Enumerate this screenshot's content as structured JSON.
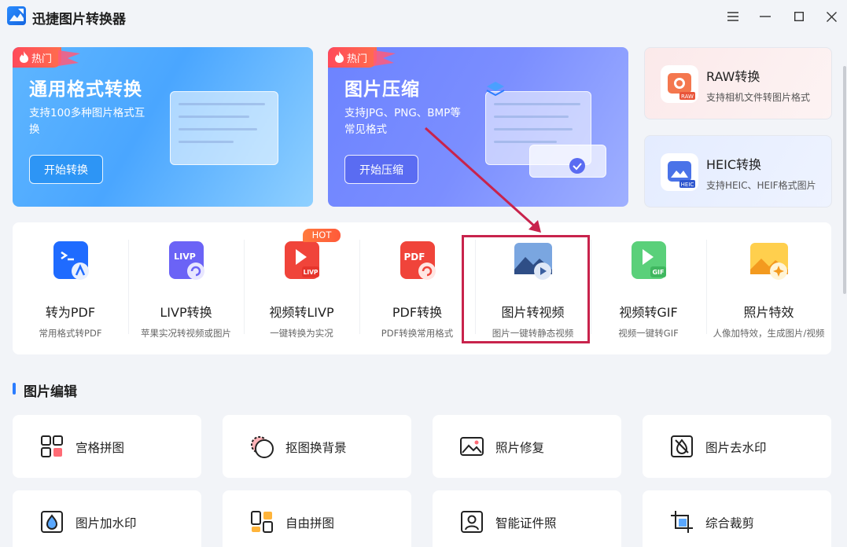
{
  "app": {
    "title": "迅捷图片转换器",
    "window_controls": [
      "menu-icon",
      "minimize-icon",
      "maximize-icon",
      "close-icon"
    ]
  },
  "banners": [
    {
      "tag": "热门",
      "title": "通用格式转换",
      "desc": "支持100多种图片格式互换",
      "button": "开始转换"
    },
    {
      "tag": "热门",
      "title": "图片压缩",
      "desc": "支持JPG、PNG、BMP等常见格式",
      "button": "开始压缩"
    }
  ],
  "side_cards": [
    {
      "title": "RAW转换",
      "sub": "支持相机文件转图片格式",
      "icon": "raw-icon",
      "icon_badge": "RAW"
    },
    {
      "title": "HEIC转换",
      "sub": "支持HEIC、HEIF格式图片",
      "icon": "heic-icon",
      "icon_badge": "HEIC"
    }
  ],
  "tools": [
    {
      "name": "转为PDF",
      "sub": "常用格式转PDF",
      "icon": "to-pdf-icon",
      "color": "#1f6bff"
    },
    {
      "name": "LIVP转换",
      "sub": "苹果实况转视频或图片",
      "icon": "livp-icon",
      "color": "#6b63f6",
      "icon_text": "LIVP"
    },
    {
      "name": "视频转LIVP",
      "sub": "一键转换为实况",
      "icon": "video-to-livp-icon",
      "color": "#f0443a",
      "badge": "HOT",
      "icon_text": "LIVP"
    },
    {
      "name": "PDF转换",
      "sub": "PDF转换常用格式",
      "icon": "pdf-convert-icon",
      "color": "#f0443a",
      "icon_text": "PDF"
    },
    {
      "name": "图片转视频",
      "sub": "图片一键转静态视频",
      "icon": "image-to-video-icon",
      "color": "#5b7fc0"
    },
    {
      "name": "视频转GIF",
      "sub": "视频一键转GIF",
      "icon": "video-to-gif-icon",
      "color": "#3fc36a",
      "icon_text": "GIF"
    },
    {
      "name": "照片特效",
      "sub": "人像加特效，生成图片/视频",
      "icon": "photo-effects-icon",
      "color": "#f7b42c"
    }
  ],
  "section": {
    "title": "图片编辑"
  },
  "edit_tools": [
    {
      "label": "宫格拼图",
      "icon": "grid-collage-icon"
    },
    {
      "label": "抠图换背景",
      "icon": "cutout-icon"
    },
    {
      "label": "照片修复",
      "icon": "photo-repair-icon"
    },
    {
      "label": "图片去水印",
      "icon": "remove-watermark-icon"
    },
    {
      "label": "图片加水印",
      "icon": "add-watermark-icon"
    },
    {
      "label": "自由拼图",
      "icon": "free-collage-icon"
    },
    {
      "label": "智能证件照",
      "icon": "id-photo-icon"
    },
    {
      "label": "综合裁剪",
      "icon": "crop-icon"
    }
  ],
  "colors": {
    "accent": "#2b7cff",
    "highlight": "#c8234c",
    "hot": "#ff4a5a"
  }
}
